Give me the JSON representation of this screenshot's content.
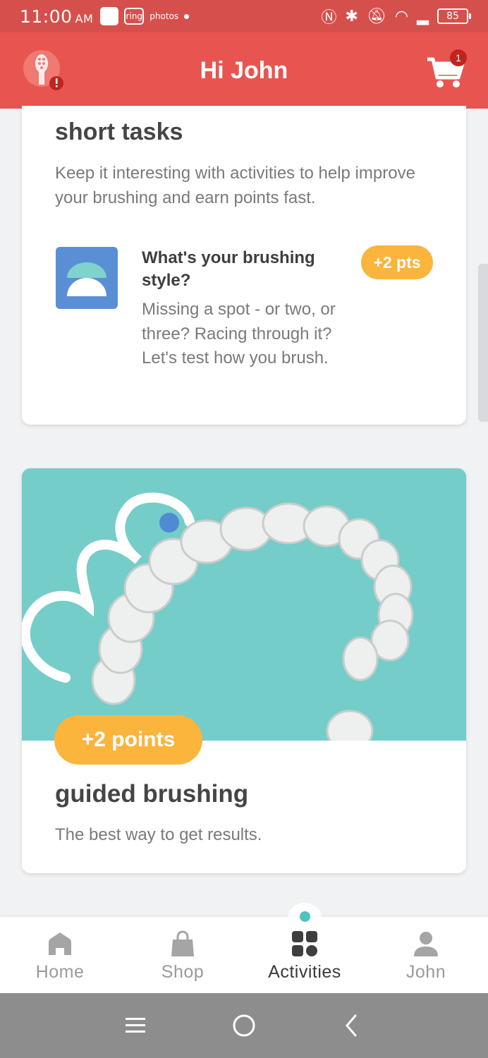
{
  "status_bar": {
    "time": "11:00",
    "ampm": "AM",
    "ring_label": "ring",
    "photos_label": "photos",
    "battery": "85"
  },
  "header": {
    "title": "Hi John",
    "cart_count": "1"
  },
  "short_tasks": {
    "title": "short tasks",
    "description": "Keep it interesting with activities to help improve your brushing and earn points fast.",
    "task": {
      "title": "What's your brushing style?",
      "description": "Missing a spot - or two, or three? Racing through it? Let's test how you brush.",
      "points": "+2 pts"
    }
  },
  "guided_brushing": {
    "points": "+2 points",
    "title": "guided brushing",
    "description": "The best way to get results."
  },
  "bottom_nav": {
    "items": [
      {
        "label": "Home",
        "icon": "home-icon"
      },
      {
        "label": "Shop",
        "icon": "shopping-bag-icon"
      },
      {
        "label": "Activities",
        "icon": "activities-grid-icon",
        "active": true
      },
      {
        "label": "John",
        "icon": "profile-icon"
      }
    ]
  },
  "colors": {
    "header": "#e85550",
    "status_bar": "#d5504c",
    "accent_orange": "#fbb43c",
    "teal": "#74cdc9",
    "task_icon_blue": "#5a8fd6"
  }
}
